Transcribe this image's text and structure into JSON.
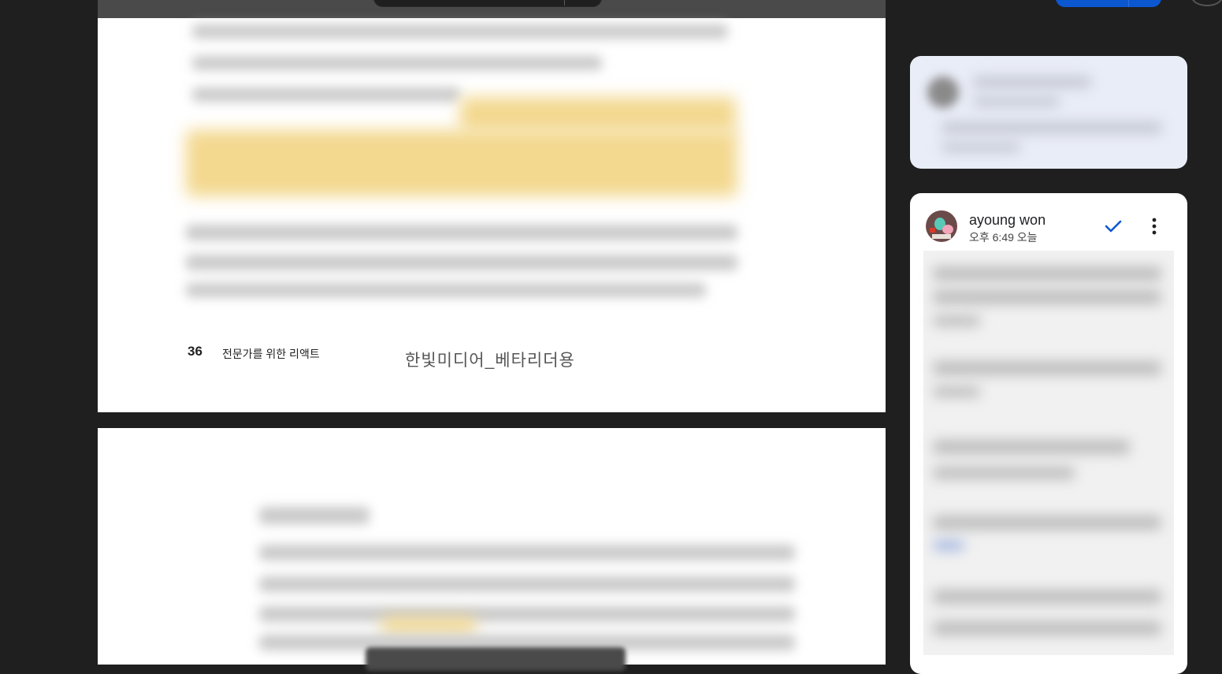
{
  "document": {
    "page_number": "36",
    "book_title": "전문가를 위한 리액트",
    "watermark": "한빛미디어_베타리더용"
  },
  "comment": {
    "author": "ayoung won",
    "timestamp": "오후 6:49 오늘"
  },
  "icons": {
    "resolve": "checkmark-icon",
    "more": "more-vert-icon"
  },
  "colors": {
    "accent": "#0b57d0",
    "highlight": "#f3d88f",
    "background": "#1f1f1f"
  }
}
